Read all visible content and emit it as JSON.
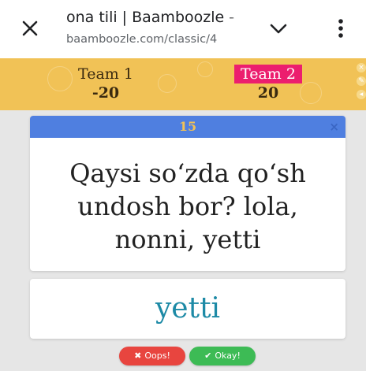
{
  "browser": {
    "page_title": "ona tili | Baamboozle - ",
    "url": "baamboozle.com/classic/4",
    "close_icon": "close-icon",
    "chevron_icon": "chevron-down-icon",
    "menu_icon": "more-vert-icon"
  },
  "scoreboard": {
    "teams": [
      {
        "name": "Team 1",
        "score": "-20",
        "active": false
      },
      {
        "name": "Team 2",
        "score": "20",
        "active": true
      }
    ],
    "active_color": "#ec1e6e",
    "bar_color": "#f1c256"
  },
  "question_card": {
    "points": "15",
    "question": "Qaysi so‘zda qo‘sh undosh bor? lola, nonni, yetti",
    "close_label": "×",
    "header_color": "#4f7fe0"
  },
  "answer_card": {
    "answer": "yetti",
    "answer_color": "#1d8aa6"
  },
  "buttons": {
    "oops_icon": "✖",
    "oops_label": "Oops!",
    "okay_icon": "✔",
    "okay_label": "Okay!"
  }
}
